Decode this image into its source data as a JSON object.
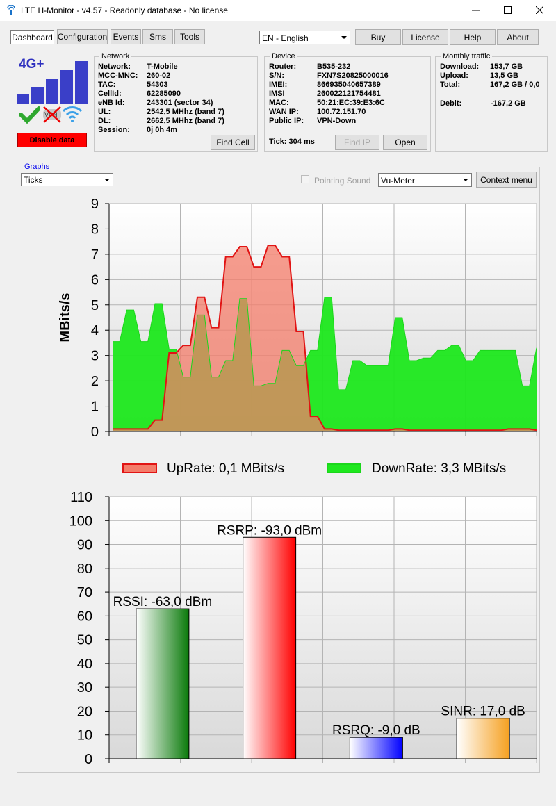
{
  "window": {
    "title": "LTE H-Monitor - v4.57 - Readonly database - No license"
  },
  "tabs": [
    {
      "label": "Dashboard",
      "active": true
    },
    {
      "label": "Configuration"
    },
    {
      "label": "Events"
    },
    {
      "label": "Sms"
    },
    {
      "label": "Tools"
    }
  ],
  "toolbar": {
    "language": "EN - English",
    "buy": "Buy",
    "license": "License",
    "help": "Help",
    "about": "About"
  },
  "status_icon": {
    "label": "4G+",
    "vpn": "VPN",
    "disable_button": "Disable data"
  },
  "network": {
    "legend": "Network",
    "fields": [
      {
        "k": "Network:",
        "v": "T-Mobile"
      },
      {
        "k": "MCC-MNC:",
        "v": "260-02"
      },
      {
        "k": "TAC:",
        "v": "54303"
      },
      {
        "k": "CellId:",
        "v": "62285090"
      },
      {
        "k": "eNB Id:",
        "v": "243301 (sector 34)"
      },
      {
        "k": "UL:",
        "v": "2542,5 MHhz (band 7)"
      },
      {
        "k": "DL:",
        "v": "2662,5 MHhz (band 7)"
      },
      {
        "k": "Session:",
        "v": "0j 0h 4m"
      }
    ],
    "find_cell": "Find Cell"
  },
  "device": {
    "legend": "Device",
    "fields": [
      {
        "k": "Router:",
        "v": "B535-232"
      },
      {
        "k": "S/N:",
        "v": "FXN7S20825000016"
      },
      {
        "k": "IMEI:",
        "v": "866935040657389"
      },
      {
        "k": "IMSI",
        "v": "260022121754481"
      },
      {
        "k": "MAC:",
        "v": "50:21:EC:39:E3:6C"
      },
      {
        "k": "WAN IP:",
        "v": "100.72.151.70"
      },
      {
        "k": "Public IP:",
        "v": "VPN-Down"
      }
    ],
    "tick": "Tick: 304 ms",
    "find_ip": "Find IP",
    "open": "Open"
  },
  "monthly": {
    "legend": "Monthly traffic",
    "fields": [
      {
        "k": "Download:",
        "v": "153,7 GB"
      },
      {
        "k": "Upload:",
        "v": "13,5 GB"
      },
      {
        "k": "Total:",
        "v": "167,2 GB / 0,0"
      }
    ],
    "debit_k": "Debit:",
    "debit_v": "-167,2 GB"
  },
  "graphs": {
    "legend": "Graphs",
    "mode": "Ticks",
    "pointing_sound": "Pointing Sound",
    "meter": "Vu-Meter",
    "context_menu": "Context menu"
  },
  "colors": {
    "up": "#f47c6a",
    "up_line": "#e11414",
    "down": "#1ee81e",
    "down_line": "#1bd61b",
    "overlap": "#d2884a"
  },
  "chart_data": [
    {
      "type": "area",
      "ylabel": "MBits/s",
      "ylim": [
        0,
        9
      ],
      "yticks": [
        "0",
        "1",
        "2",
        "3",
        "4",
        "5",
        "6",
        "7",
        "8",
        "9"
      ],
      "series": [
        {
          "name": "UpRate: 0,1 MBits/s",
          "values": [
            0.1,
            0.1,
            0.1,
            0.1,
            0.1,
            0.1,
            0.45,
            0.45,
            3.1,
            3.1,
            3.4,
            3.4,
            5.3,
            5.3,
            4.1,
            4.1,
            6.9,
            6.9,
            7.3,
            7.3,
            6.5,
            6.5,
            7.35,
            7.35,
            6.9,
            6.9,
            3.95,
            3.95,
            0.6,
            0.6,
            0.1,
            0.1,
            0.05,
            0.05,
            0.05,
            0.05,
            0.05,
            0.05,
            0.05,
            0.05,
            0.1,
            0.1,
            0.05,
            0.05,
            0.05,
            0.05,
            0.05,
            0.05,
            0.05,
            0.05,
            0.05,
            0.05,
            0.05,
            0.05,
            0.05,
            0.05,
            0.1,
            0.1,
            0.1,
            0.1,
            0.05
          ]
        },
        {
          "name": "DownRate: 3,3 MBits/s",
          "values": [
            3.55,
            3.55,
            4.8,
            4.8,
            3.55,
            3.55,
            5.05,
            5.05,
            3.25,
            3.25,
            2.15,
            2.15,
            4.6,
            4.6,
            2.15,
            2.15,
            2.8,
            2.8,
            5.25,
            5.25,
            1.8,
            1.8,
            1.9,
            1.9,
            3.2,
            3.2,
            2.6,
            2.6,
            3.2,
            3.2,
            5.3,
            5.3,
            1.65,
            1.65,
            2.8,
            2.8,
            2.6,
            2.6,
            2.6,
            2.6,
            4.5,
            4.5,
            2.8,
            2.8,
            2.9,
            2.9,
            3.2,
            3.2,
            3.4,
            3.4,
            2.8,
            2.8,
            3.2,
            3.2,
            3.2,
            3.2,
            3.2,
            3.2,
            1.8,
            1.8,
            3.3
          ]
        }
      ]
    },
    {
      "type": "bar",
      "ylim": [
        0,
        110
      ],
      "yticks": [
        "0",
        "10",
        "20",
        "30",
        "40",
        "50",
        "60",
        "70",
        "80",
        "90",
        "100",
        "110"
      ],
      "bars": [
        {
          "label": "RSSI: -63,0 dBm",
          "value": 63,
          "color": "#0a7a0a"
        },
        {
          "label": "RSRP: -93,0 dBm",
          "value": 93,
          "color": "#ff0000"
        },
        {
          "label": "RSRQ: -9,0 dB",
          "value": 9,
          "color": "#0000ff"
        },
        {
          "label": "SINR: 17,0 dB",
          "value": 17,
          "color": "#f5a020"
        }
      ]
    }
  ]
}
